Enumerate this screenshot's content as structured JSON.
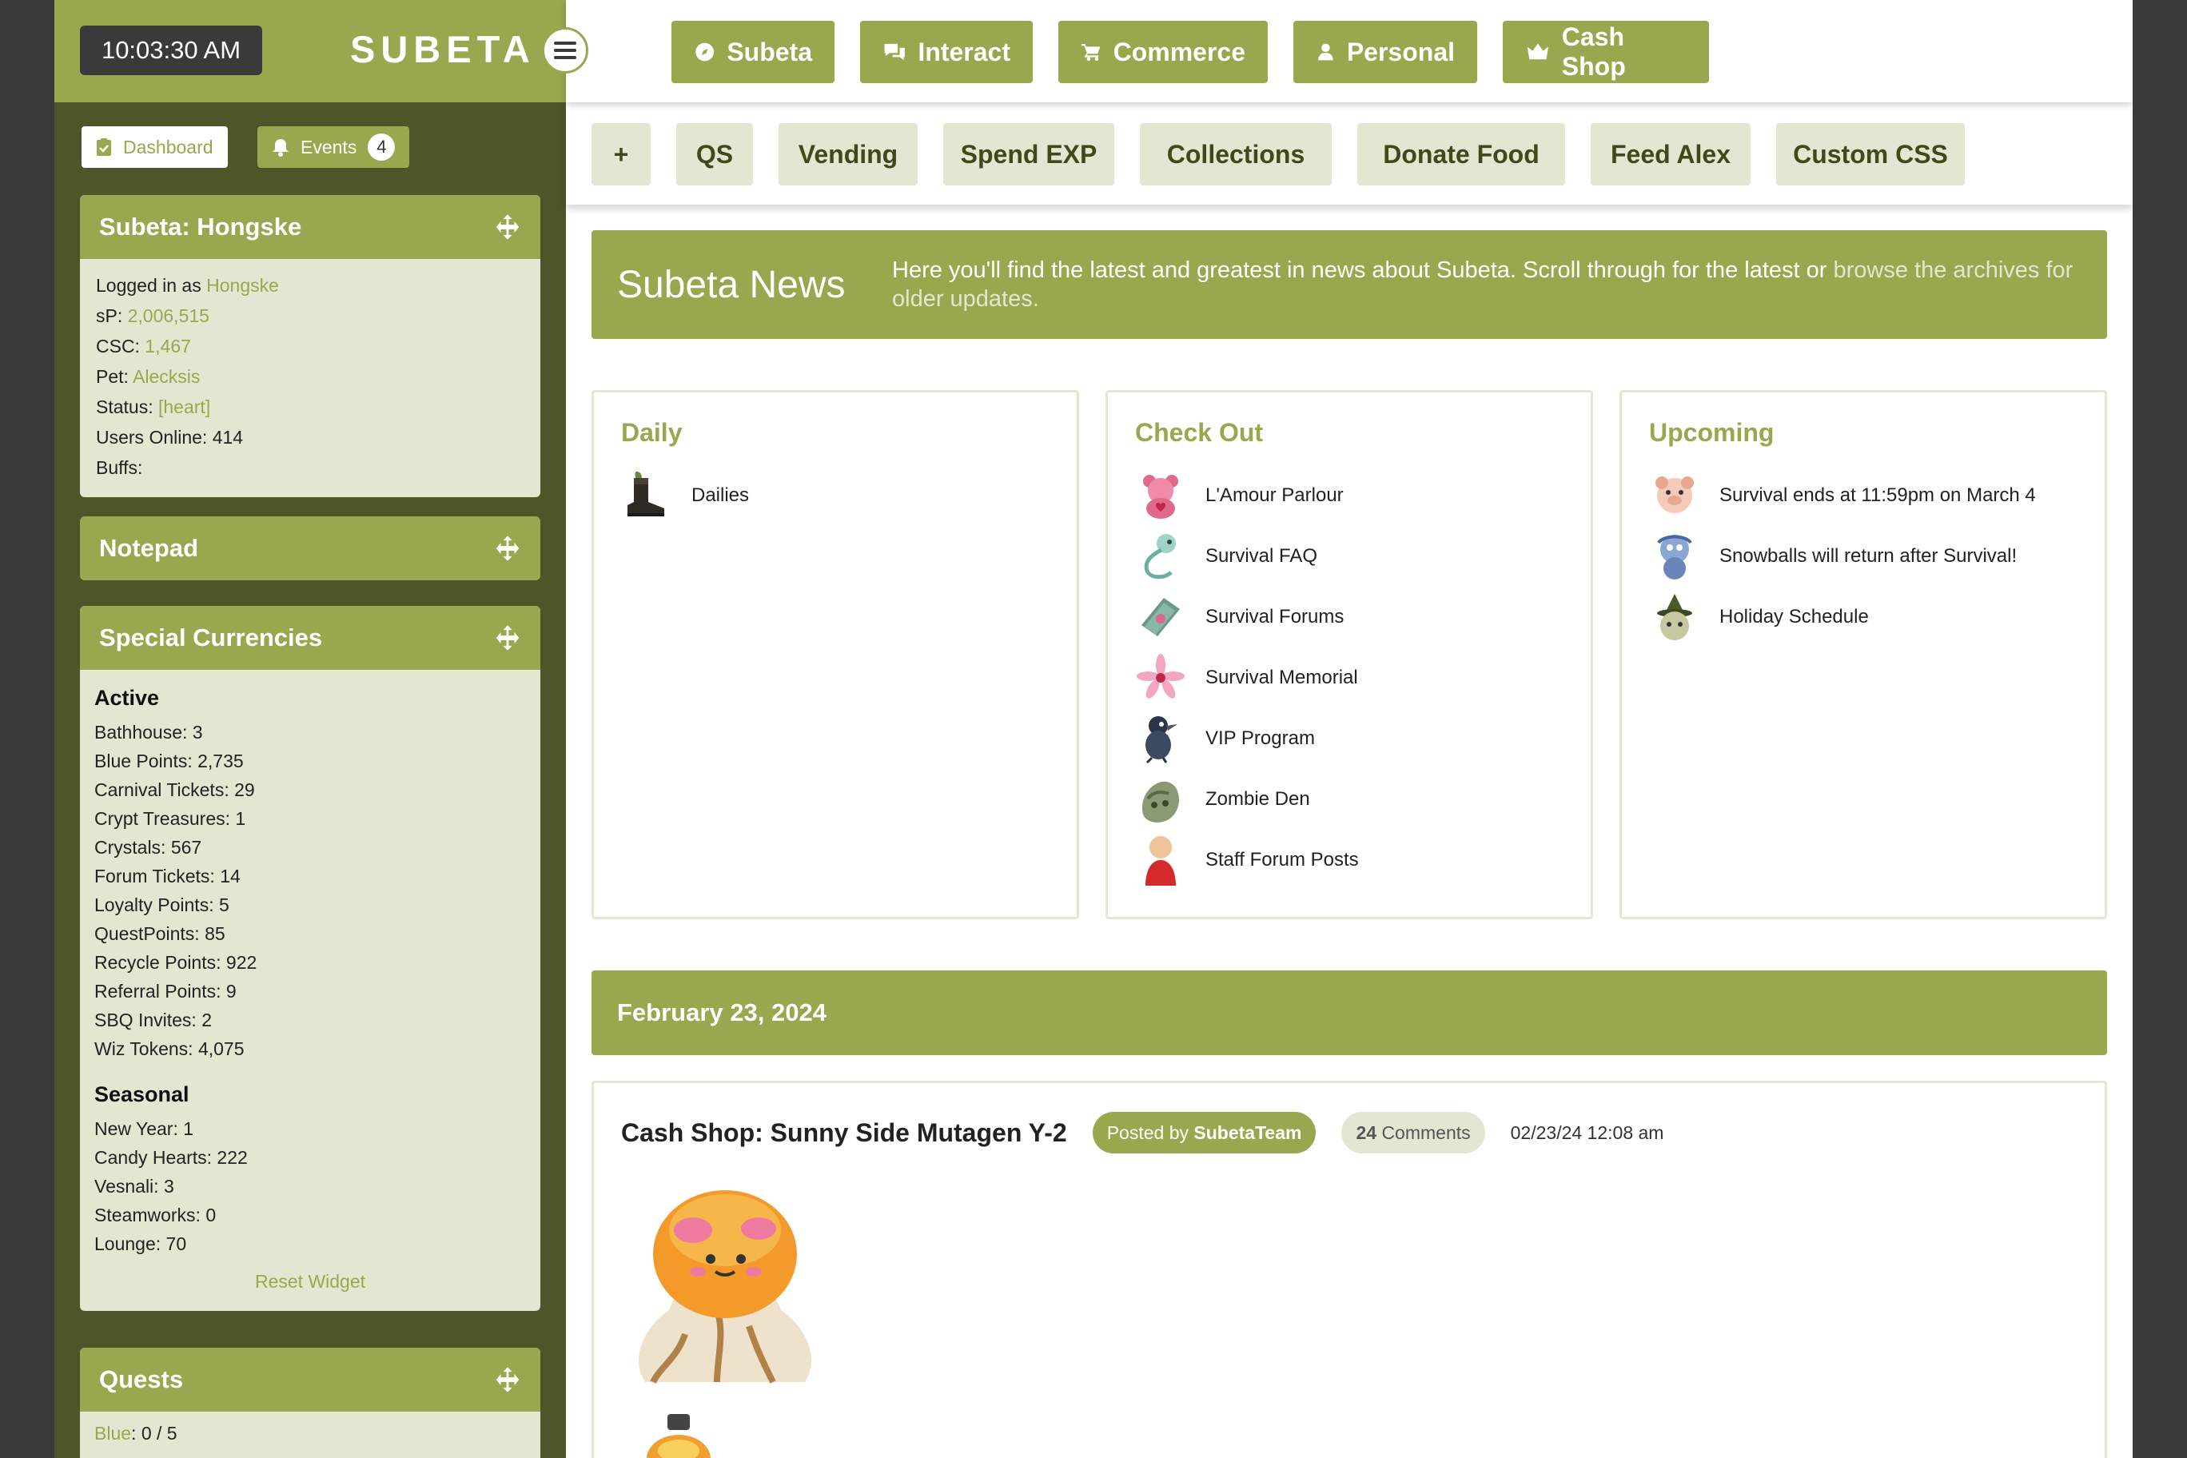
{
  "header": {
    "clock": "10:03:30 AM",
    "logo": "SUBETA",
    "nav": [
      {
        "label": "Subeta",
        "icon": "compass-icon"
      },
      {
        "label": "Interact",
        "icon": "chat-icon"
      },
      {
        "label": "Commerce",
        "icon": "cart-icon"
      },
      {
        "label": "Personal",
        "icon": "user-icon"
      },
      {
        "label": "Cash Shop",
        "icon": "crown-icon"
      }
    ]
  },
  "subnav": [
    "+",
    "QS",
    "Vending",
    "Spend EXP",
    "Collections",
    "Donate Food",
    "Feed Alex",
    "Custom CSS"
  ],
  "sidebar": {
    "dashboard_label": "Dashboard",
    "events_label": "Events",
    "events_count": "4",
    "account": {
      "title": "Subeta: Hongske",
      "logged_in_label": "Logged in as",
      "username": "Hongske",
      "sp_label": "sP:",
      "sp": "2,006,515",
      "csc_label": "CSC:",
      "csc": "1,467",
      "pet_label": "Pet:",
      "pet": "Alecksis",
      "status_label": "Status:",
      "status": "[heart]",
      "users_online": "Users Online: 414",
      "buffs": "Buffs:"
    },
    "notepad_title": "Notepad",
    "currencies": {
      "title": "Special Currencies",
      "active_heading": "Active",
      "active": [
        "Bathhouse: 3",
        "Blue Points: 2,735",
        "Carnival Tickets: 29",
        "Crypt Treasures: 1",
        "Crystals: 567",
        "Forum Tickets: 14",
        "Loyalty Points: 5",
        "QuestPoints: 85",
        "Recycle Points: 922",
        "Referral Points: 9",
        "SBQ Invites: 2",
        "Wiz Tokens: 4,075"
      ],
      "seasonal_heading": "Seasonal",
      "seasonal": [
        "New Year: 1",
        "Candy Hearts: 222",
        "Vesnali: 3",
        "Steamworks: 0",
        "Lounge: 70"
      ],
      "reset": "Reset Widget"
    },
    "quests": {
      "title": "Quests",
      "blue_label": "Blue",
      "blue_value": ": 0 / 5"
    }
  },
  "news": {
    "title": "Subeta News",
    "desc": "Here you'll find the latest and greatest in news about Subeta. Scroll through for the latest or",
    "archive_link": "browse the archives for older updates."
  },
  "panels": {
    "daily": {
      "title": "Daily",
      "items": [
        "Dailies"
      ]
    },
    "checkout": {
      "title": "Check Out",
      "items": [
        "L'Amour Parlour",
        "Survival FAQ",
        "Survival Forums",
        "Survival Memorial",
        "VIP Program",
        "Zombie Den",
        "Staff Forum Posts"
      ]
    },
    "upcoming": {
      "title": "Upcoming",
      "items": [
        "Survival ends at 11:59pm on March 4",
        "Snowballs will return after Survival!",
        "Holiday Schedule"
      ]
    }
  },
  "date_heading": "February 23, 2024",
  "post": {
    "title": "Cash Shop: Sunny Side Mutagen Y-2",
    "posted_by_label": "Posted by",
    "author": "SubetaTeam",
    "comments_count": "24",
    "comments_label": "Comments",
    "time": "02/23/24 12:08 am"
  },
  "colors": {
    "accent": "#99a74e",
    "sidebar_bg": "#4d5629",
    "light": "#e3e6d1"
  }
}
